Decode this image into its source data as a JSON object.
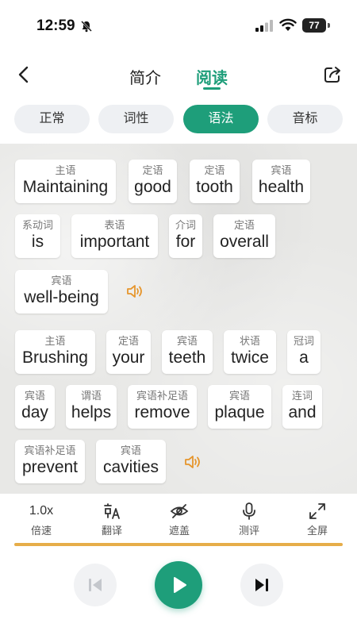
{
  "status": {
    "time": "12:59",
    "battery": "77"
  },
  "nav": {
    "tabs": [
      "简介",
      "阅读"
    ],
    "active": "阅读"
  },
  "modes": [
    "正常",
    "词性",
    "语法",
    "音标"
  ],
  "active_mode": "语法",
  "sentences": [
    {
      "words": [
        {
          "tag": "主语",
          "word": "Maintaining"
        },
        {
          "tag": "定语",
          "word": "good"
        },
        {
          "tag": "定语",
          "word": "tooth"
        },
        {
          "tag": "宾语",
          "word": "health"
        },
        {
          "tag": "系动词",
          "word": "is"
        },
        {
          "tag": "表语",
          "word": "important"
        },
        {
          "tag": "介词",
          "word": "for"
        },
        {
          "tag": "定语",
          "word": "overall"
        },
        {
          "tag": "宾语",
          "word": "well-being"
        }
      ]
    },
    {
      "words": [
        {
          "tag": "主语",
          "word": "Brushing"
        },
        {
          "tag": "定语",
          "word": "your"
        },
        {
          "tag": "宾语",
          "word": "teeth"
        },
        {
          "tag": "状语",
          "word": "twice"
        },
        {
          "tag": "冠词",
          "word": "a"
        },
        {
          "tag": "宾语",
          "word": "day"
        },
        {
          "tag": "谓语",
          "word": "helps"
        },
        {
          "tag": "宾语补足语",
          "word": "remove"
        },
        {
          "tag": "宾语",
          "word": "plaque"
        },
        {
          "tag": "连词",
          "word": "and"
        },
        {
          "tag": "宾语补足语",
          "word": "prevent"
        },
        {
          "tag": "宾语",
          "word": "cavities"
        }
      ]
    }
  ],
  "toolbar": {
    "speed_value": "1.0x",
    "speed_label": "倍速",
    "translate_label": "翻译",
    "cover_label": "遮盖",
    "evaluate_label": "测评",
    "fullscreen_label": "全屏"
  },
  "colors": {
    "accent": "#1e9e7a",
    "progress": "#e6ad49",
    "speaker": "#e6962d"
  },
  "icons": {
    "back": "chevron-left-icon",
    "share": "share-icon",
    "speaker": "speaker-icon",
    "translate": "translate-icon",
    "cover": "eye-slash-icon",
    "evaluate": "microphone-icon",
    "fullscreen": "expand-icon",
    "prev": "skip-previous-icon",
    "play": "play-icon",
    "next": "skip-next-icon"
  }
}
